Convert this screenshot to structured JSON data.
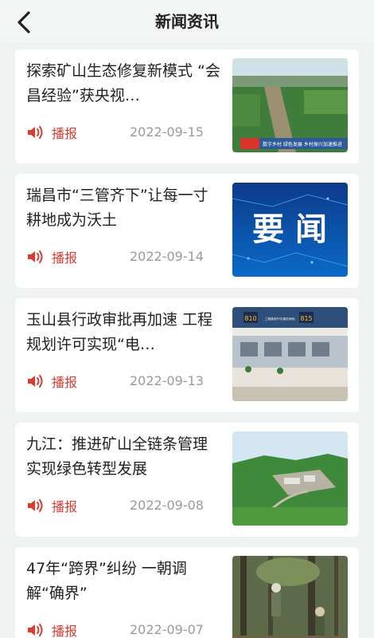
{
  "header": {
    "title": "新闻资讯"
  },
  "news": [
    {
      "title": "探索矿山生态修复新模式 “会昌经验”获央视…",
      "action": "播报",
      "date": "2022-09-15",
      "thumb_caption": "数字乡村 绿色发展 乡村振兴加速推进"
    },
    {
      "title": "瑞昌市“三管齐下”让每一寸耕地成为沃土",
      "action": "播报",
      "date": "2022-09-14",
      "thumb_text": "要 闻"
    },
    {
      "title": "玉山县行政审批再加速 工程规划许可实现“电…",
      "action": "播报",
      "date": "2022-09-13",
      "thumb_codes": [
        "810",
        "工程建设许可(建设用地)",
        "815"
      ]
    },
    {
      "title": "九江：推进矿山全链条管理 实现绿色转型发展",
      "action": "播报",
      "date": "2022-09-08"
    },
    {
      "title": "47年“跨界”纠纷 一朝调解“确界”",
      "action": "播报",
      "date": "2022-09-07"
    }
  ]
}
